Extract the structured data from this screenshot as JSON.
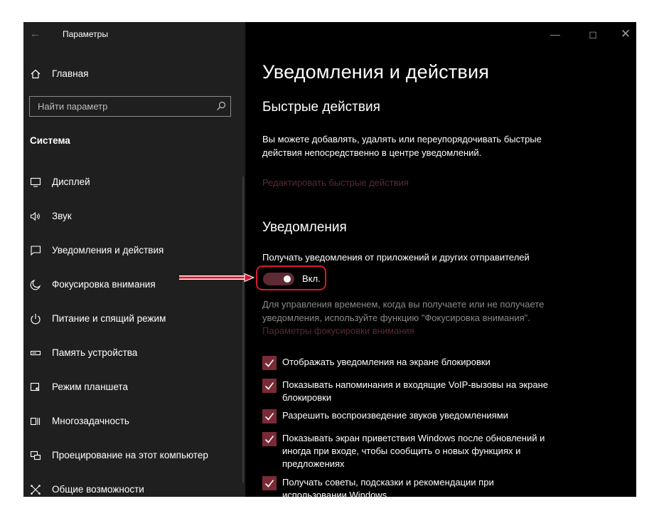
{
  "app": {
    "title": "Параметры"
  },
  "sidebar": {
    "home_label": "Главная",
    "search": {
      "placeholder": "Найти параметр"
    },
    "section": "Система",
    "items": [
      {
        "label": "Дисплей",
        "icon": "monitor-icon"
      },
      {
        "label": "Звук",
        "icon": "speaker-icon"
      },
      {
        "label": "Уведомления и действия",
        "icon": "message-icon"
      },
      {
        "label": "Фокусировка внимания",
        "icon": "moon-icon"
      },
      {
        "label": "Питание и спящий режим",
        "icon": "power-icon"
      },
      {
        "label": "Память устройства",
        "icon": "storage-icon"
      },
      {
        "label": "Режим планшета",
        "icon": "tablet-icon"
      },
      {
        "label": "Многозадачность",
        "icon": "multitask-icon"
      },
      {
        "label": "Проецирование на этот компьютер",
        "icon": "projector-icon"
      },
      {
        "label": "Общие возможности",
        "icon": "share-icon"
      }
    ]
  },
  "main": {
    "title": "Уведомления и действия",
    "quick_actions": {
      "heading": "Быстрые действия",
      "description": "Вы можете добавлять, удалять или переупорядочивать быстрые действия непосредственно в центре уведомлений.",
      "edit_link": "Редактировать быстрые действия"
    },
    "notifications": {
      "heading": "Уведомления",
      "receive_label": "Получать уведомления от приложений и других отправителей",
      "toggle_state": "Вкл.",
      "toggle_on": true,
      "focus_hint": "Для управления временем, когда вы получаете или не получаете уведомления, используйте функцию \"Фокусировка внимания\".",
      "focus_link": "Параметры фокусировки внимания",
      "checkboxes": [
        {
          "label": "Отображать уведомления на экране блокировки",
          "checked": true
        },
        {
          "label": "Показывать напоминания и входящие VoIP-вызовы на экране блокировки",
          "checked": true
        },
        {
          "label": "Разрешить  воспроизведение звуков уведомлениями",
          "checked": true
        },
        {
          "label": "Показывать экран приветствия Windows после обновлений и иногда при входе, чтобы сообщить о новых функциях и предложениях",
          "checked": true
        },
        {
          "label": "Получать советы, подсказки и рекомендации при использовании Windows",
          "checked": true
        }
      ]
    }
  },
  "colors": {
    "accent": "#7a2a36",
    "annotation": "#d9182d",
    "link": "#5a2a33"
  }
}
